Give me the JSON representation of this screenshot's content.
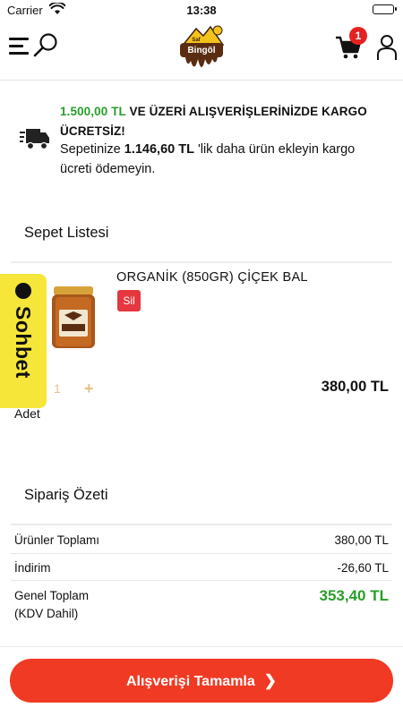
{
  "status_bar": {
    "carrier": "Carrier",
    "time": "13:38"
  },
  "header": {
    "logo_text_top": "Saf",
    "logo_text_main": "Bingöl",
    "cart_count": "1"
  },
  "shipping_notice": {
    "threshold": "1.500,00 TL",
    "headline_rest": "VE ÜZERİ ALIŞVERİŞLERİNİZDE KARGO ÜCRETSİZ!",
    "line2_prefix": "Sepetinize",
    "remaining": "1.146,60 TL",
    "line2_suffix": "'lik daha ürün ekleyin kargo ücreti ödemeyin."
  },
  "cart": {
    "title": "Sepet Listesi",
    "items": [
      {
        "name": "ORGANİK (850GR) ÇİÇEK BAL",
        "remove_label": "Sil",
        "quantity": "1",
        "unit": "Adet",
        "price": "380,00 TL"
      }
    ]
  },
  "chat": {
    "label": "Sohbet"
  },
  "summary": {
    "title": "Sipariş Özeti",
    "subtotal_label": "Ürünler Toplamı",
    "subtotal_value": "380,00 TL",
    "discount_label": "İndirim",
    "discount_value": "-26,60 TL",
    "total_label_line1": "Genel Toplam",
    "total_label_line2": "(KDV Dahil)",
    "total_value": "353,40 TL"
  },
  "checkout": {
    "label": "Alışverişi Tamamla"
  },
  "colors": {
    "accent_green": "#2a9d2a",
    "checkout_red": "#f03a23",
    "remove_red": "#e5373f",
    "chat_yellow": "#f6e63a"
  }
}
